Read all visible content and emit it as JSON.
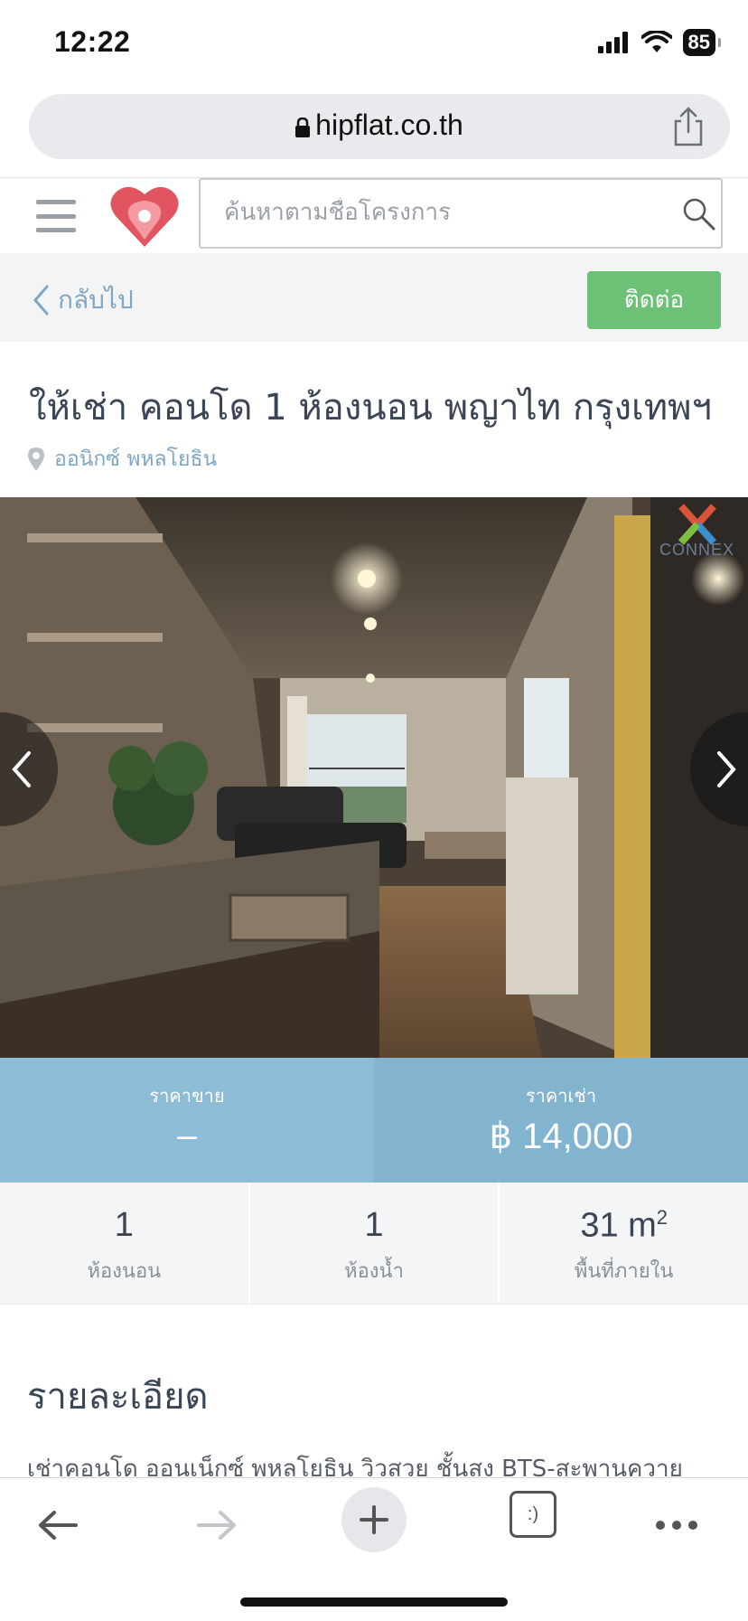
{
  "status_bar": {
    "time": "12:22",
    "battery": "85"
  },
  "browser": {
    "url": "hipflat.co.th"
  },
  "header": {
    "search_placeholder": "ค้นหาตามชื่อโครงการ"
  },
  "nav": {
    "back_label": "กลับไป",
    "contact_label": "ติดต่อ"
  },
  "listing": {
    "title": "ให้เช่า คอนโด 1 ห้องนอน พญาไท กรุงเทพฯ",
    "location": "ออนิกซ์ พหลโยธิน",
    "watermark": "CONNEX"
  },
  "prices": {
    "sale_label": "ราคาขาย",
    "sale_value": "–",
    "rent_label": "ราคาเช่า",
    "rent_value": "฿ 14,000"
  },
  "specs": {
    "bedrooms_value": "1",
    "bedrooms_label": "ห้องนอน",
    "bathrooms_value": "1",
    "bathrooms_label": "ห้องน้ำ",
    "area_value": "31 m",
    "area_unit_sup": "2",
    "area_label": "พื้นที่ภายใน"
  },
  "details": {
    "heading": "รายละเอียด",
    "text": "เช่าคอนโด ออนเน็กซ์ พหลโยธิน วิวสวย ชั้นสูง BTS-สะพานควาย"
  },
  "toolbar": {
    "tabs_label": ":)"
  },
  "colors": {
    "contact_green": "#6cc177",
    "price_blue": "#82b3cf",
    "link_blue": "#7fa6c4",
    "brand_red": "#e05560"
  },
  "icons": [
    "lock-icon",
    "share-icon",
    "menu-icon",
    "heart-pin-logo-icon",
    "search-icon",
    "chevron-left-icon",
    "map-pin-icon",
    "arrow-left-icon",
    "arrow-right-icon",
    "plus-icon",
    "tabs-icon",
    "more-icon"
  ]
}
